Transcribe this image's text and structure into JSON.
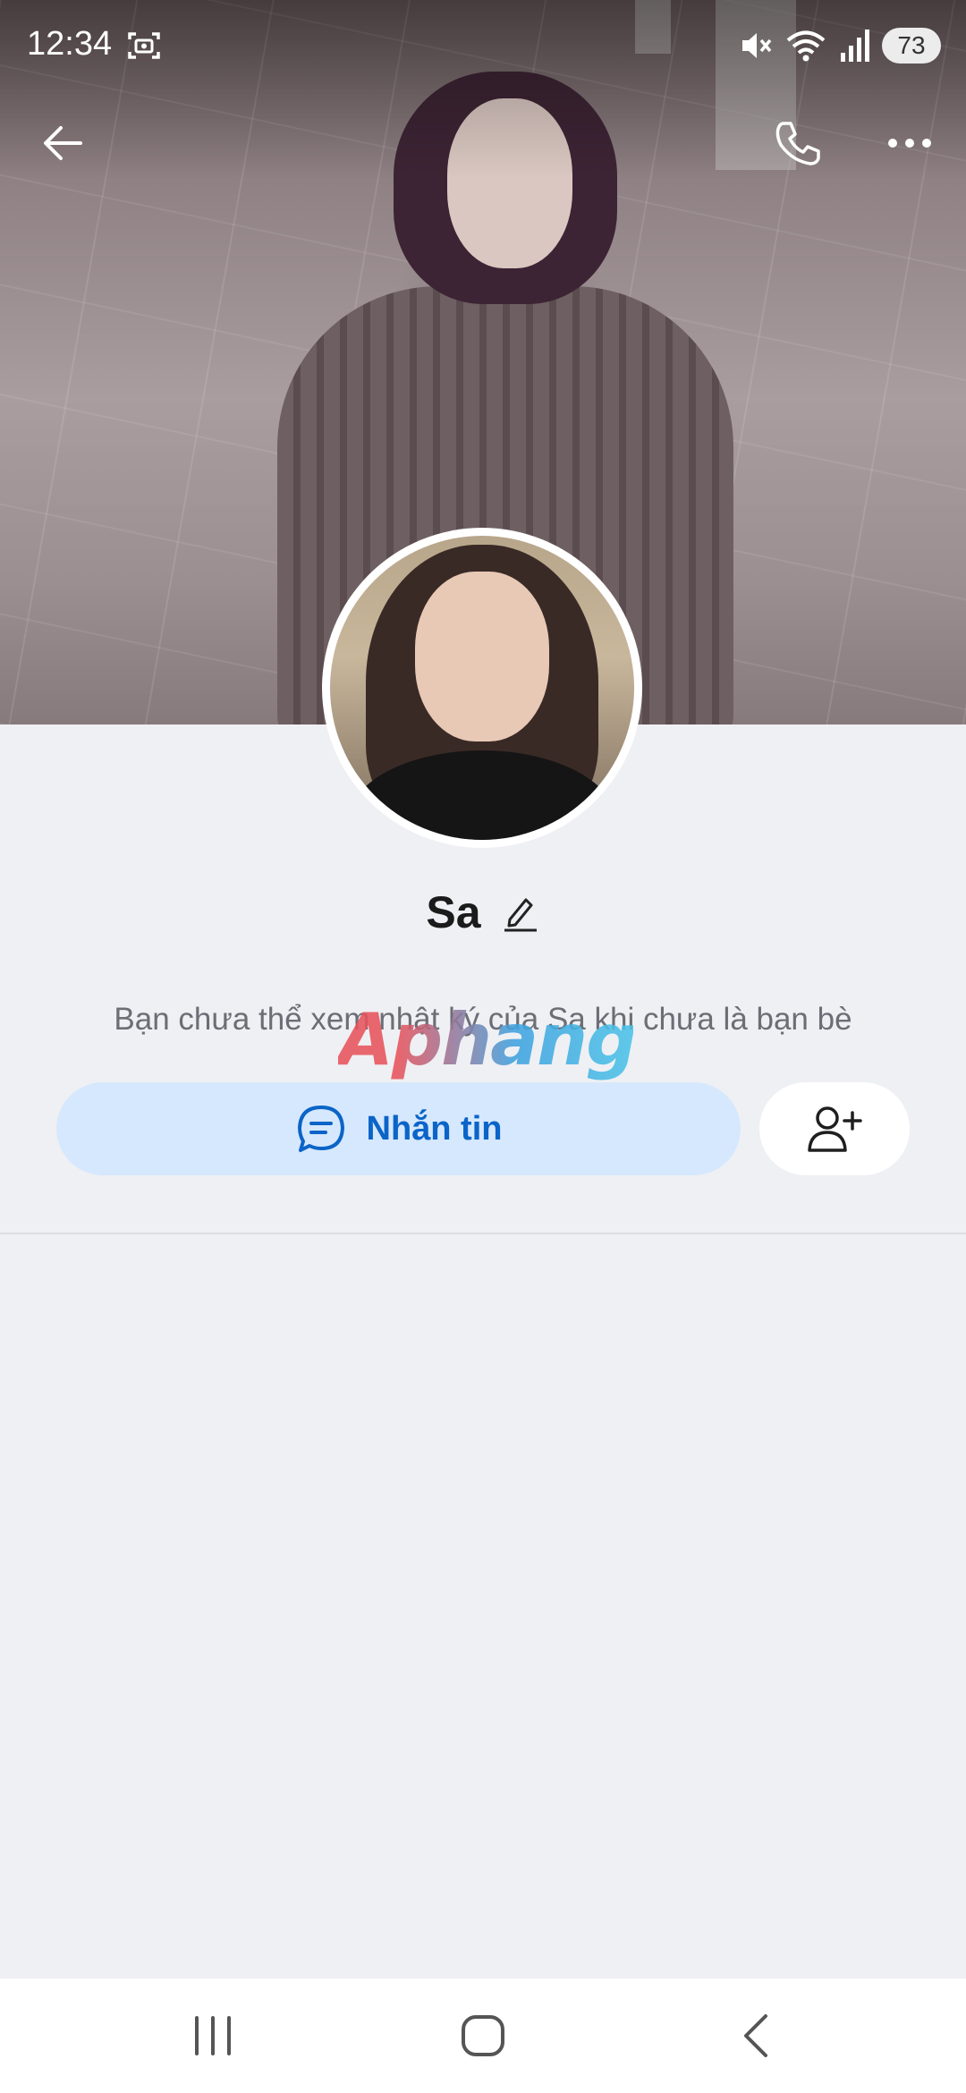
{
  "status_bar": {
    "time": "12:34",
    "battery": "73",
    "icons": [
      "screenshot-capture-icon",
      "mute-icon",
      "wifi-icon",
      "signal-icon",
      "battery-icon"
    ]
  },
  "top_actions": {
    "icons": [
      "back-arrow-icon",
      "phone-call-icon",
      "more-dots-icon"
    ]
  },
  "profile": {
    "name": "Sa",
    "diary_notice": "Bạn chưa thể xem nhật ký của Sa khi chưa là bạn bè"
  },
  "watermark": {
    "text": "Aphang"
  },
  "actions": {
    "message_label": "Nhắn tin",
    "message_icon": "chat-bubble-icon",
    "add_friend_icon": "add-friend-icon"
  },
  "colors": {
    "accent": "#0b64c8",
    "message_button_bg": "#d6e8fd",
    "page_bg": "#eff0f4"
  },
  "nav_bar": {
    "icons": [
      "recents-icon",
      "home-icon",
      "nav-back-icon"
    ]
  }
}
